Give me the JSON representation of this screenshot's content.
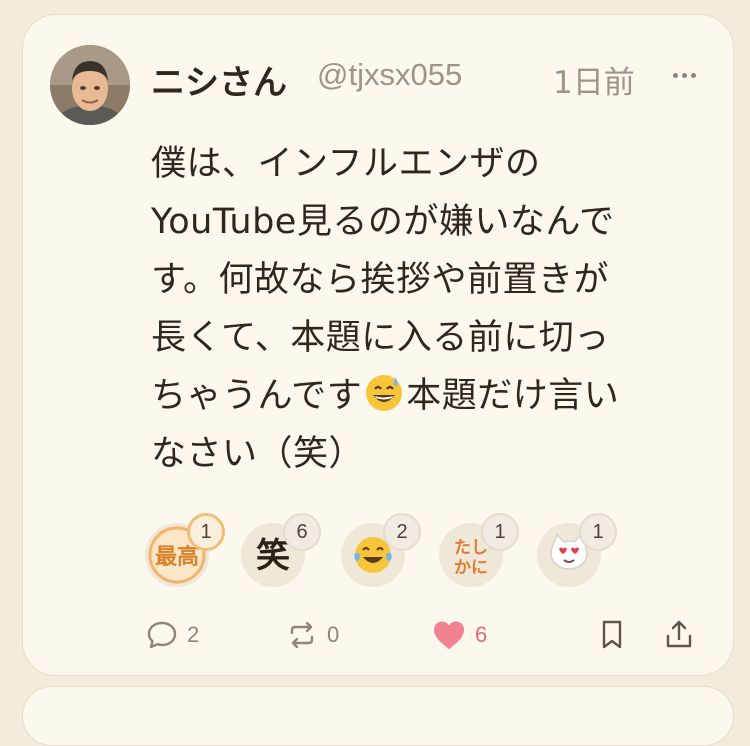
{
  "post": {
    "author_name": "ニシさん",
    "author_handle": "@tjxsx055",
    "time": "1日前",
    "body_lines": [
      "僕は、インフルエンザの",
      "YouTube見るのが嫌いなんで",
      "す。何故なら挨拶や前置きが",
      "長くて、本題に入る前に切っ",
      "ちゃうんです",
      "本題だけ言い",
      "なさい（笑）"
    ]
  },
  "reactions": [
    {
      "label": "最高",
      "icon": "saikou-badge-icon",
      "count": "1"
    },
    {
      "label": "笑",
      "icon": "warai-kanji-icon",
      "count": "6"
    },
    {
      "label": "",
      "icon": "tears-of-joy-icon",
      "count": "2"
    },
    {
      "label": "たし",
      "label2": "かに",
      "icon": "tashikani-badge-icon",
      "count": "1"
    },
    {
      "label": "",
      "icon": "heart-eyes-cat-icon",
      "count": "1"
    }
  ],
  "actions": {
    "reply_count": "2",
    "renote_count": "0",
    "like_count": "6"
  },
  "colors": {
    "background": "#f3ecdd",
    "card": "#fdf8ed",
    "text": "#2e2720",
    "muted": "#9e9486",
    "like": "#e4687a",
    "active_reaction_border": "#f2bd77"
  }
}
